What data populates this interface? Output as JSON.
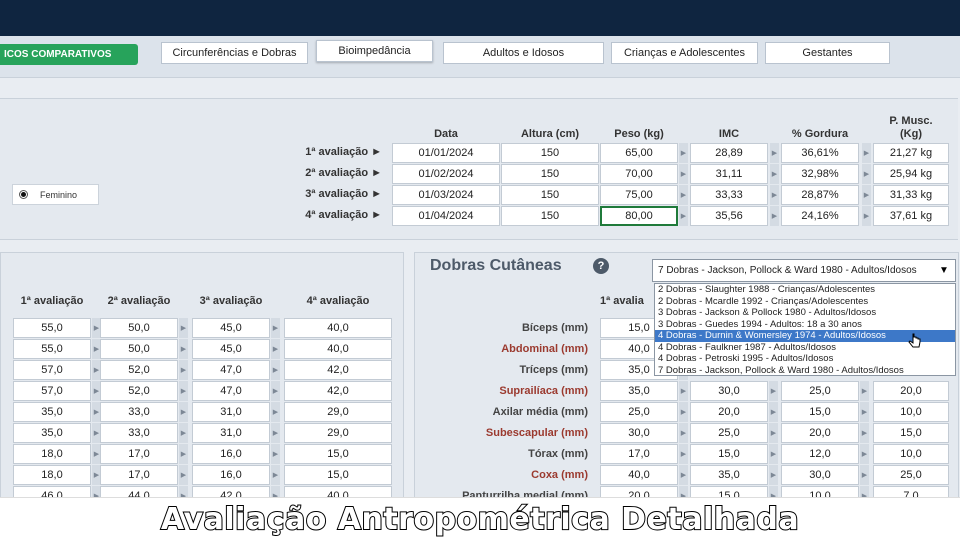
{
  "nav": {
    "green_tab": "ICOS COMPARATIVOS",
    "tabs": [
      "Circunferências e Dobras",
      "Bioimpedância",
      "Adultos e Idosos",
      "Crianças e Adolescentes",
      "Gestantes"
    ]
  },
  "top": {
    "headers": {
      "data": "Data",
      "altura": "Altura (cm)",
      "peso": "Peso (kg)",
      "imc": "IMC",
      "gordura": "% Gordura",
      "pmusc1": "P. Musc.",
      "pmusc2": "(Kg)"
    },
    "rows": [
      {
        "label": "1ª avaliação ►",
        "data": "01/01/2024",
        "altura": "150",
        "peso": "65,00",
        "imc": "28,89",
        "gordura": "36,61%",
        "pmusc": "21,27 kg"
      },
      {
        "label": "2ª avaliação ►",
        "data": "01/02/2024",
        "altura": "150",
        "peso": "70,00",
        "imc": "31,11",
        "gordura": "32,98%",
        "pmusc": "25,94 kg"
      },
      {
        "label": "3ª avaliação ►",
        "data": "01/03/2024",
        "altura": "150",
        "peso": "75,00",
        "imc": "33,33",
        "gordura": "28,87%",
        "pmusc": "31,33 kg"
      },
      {
        "label": "4ª avaliação ►",
        "data": "01/04/2024",
        "altura": "150",
        "peso": "80,00",
        "imc": "35,56",
        "gordura": "24,16%",
        "pmusc": "37,61 kg"
      }
    ],
    "gender": "Feminino"
  },
  "left": {
    "headers": [
      "1ª avaliação",
      "2ª avaliação",
      "3ª avaliação",
      "4ª avaliação"
    ],
    "rows": [
      [
        "55,0",
        "50,0",
        "45,0",
        "40,0"
      ],
      [
        "55,0",
        "50,0",
        "45,0",
        "40,0"
      ],
      [
        "57,0",
        "52,0",
        "47,0",
        "42,0"
      ],
      [
        "57,0",
        "52,0",
        "47,0",
        "42,0"
      ],
      [
        "35,0",
        "33,0",
        "31,0",
        "29,0"
      ],
      [
        "35,0",
        "33,0",
        "31,0",
        "29,0"
      ],
      [
        "18,0",
        "17,0",
        "16,0",
        "15,0"
      ],
      [
        "18,0",
        "17,0",
        "16,0",
        "15,0"
      ],
      [
        "46,0",
        "44,0",
        "42,0",
        "40,0"
      ]
    ]
  },
  "dobras": {
    "title": "Dobras Cutâneas",
    "help": "?",
    "col1": "1ª avalia",
    "selected": "7 Dobras - Jackson, Pollock & Ward 1980 - Adultos/Idosos",
    "options": [
      "2 Dobras - Slaughter 1988 - Crianças/Adolescentes",
      "2 Dobras - Mcardle 1992 - Crianças/Adolescentes",
      "3 Dobras - Jackson & Pollock 1980 - Adultos/Idosos",
      "3 Dobras - Guedes 1994 - Adultos: 18 a 30 anos",
      "4 Dobras - Durnin & Womersley 1974 - Adultos/Idosos",
      "4 Dobras - Faulkner 1987 - Adultos/Idosos",
      "4 Dobras - Petroski 1995 - Adultos/Idosos",
      "7 Dobras - Jackson, Pollock & Ward 1980 - Adultos/Idosos"
    ],
    "rows": [
      {
        "label": "Bíceps (mm)",
        "v": [
          "15,0",
          "",
          "",
          ""
        ]
      },
      {
        "label": "Abdominal (mm)",
        "v": [
          "40,0",
          "",
          "",
          ""
        ]
      },
      {
        "label": "Tríceps (mm)",
        "v": [
          "35,0",
          "",
          "",
          ""
        ]
      },
      {
        "label": "Suprailíaca (mm)",
        "v": [
          "35,0",
          "30,0",
          "25,0",
          "20,0"
        ]
      },
      {
        "label": "Axilar média (mm)",
        "v": [
          "25,0",
          "20,0",
          "15,0",
          "10,0"
        ]
      },
      {
        "label": "Subescapular (mm)",
        "v": [
          "30,0",
          "25,0",
          "20,0",
          "15,0"
        ]
      },
      {
        "label": "Tórax (mm)",
        "v": [
          "17,0",
          "15,0",
          "12,0",
          "10,0"
        ]
      },
      {
        "label": "Coxa (mm)",
        "v": [
          "40,0",
          "35,0",
          "30,0",
          "25,0"
        ]
      },
      {
        "label": "Panturrilha medial (mm)",
        "v": [
          "20,0",
          "15,0",
          "10,0",
          "7,0"
        ]
      }
    ]
  },
  "caption": "Avaliação Antropométrica Detalhada"
}
